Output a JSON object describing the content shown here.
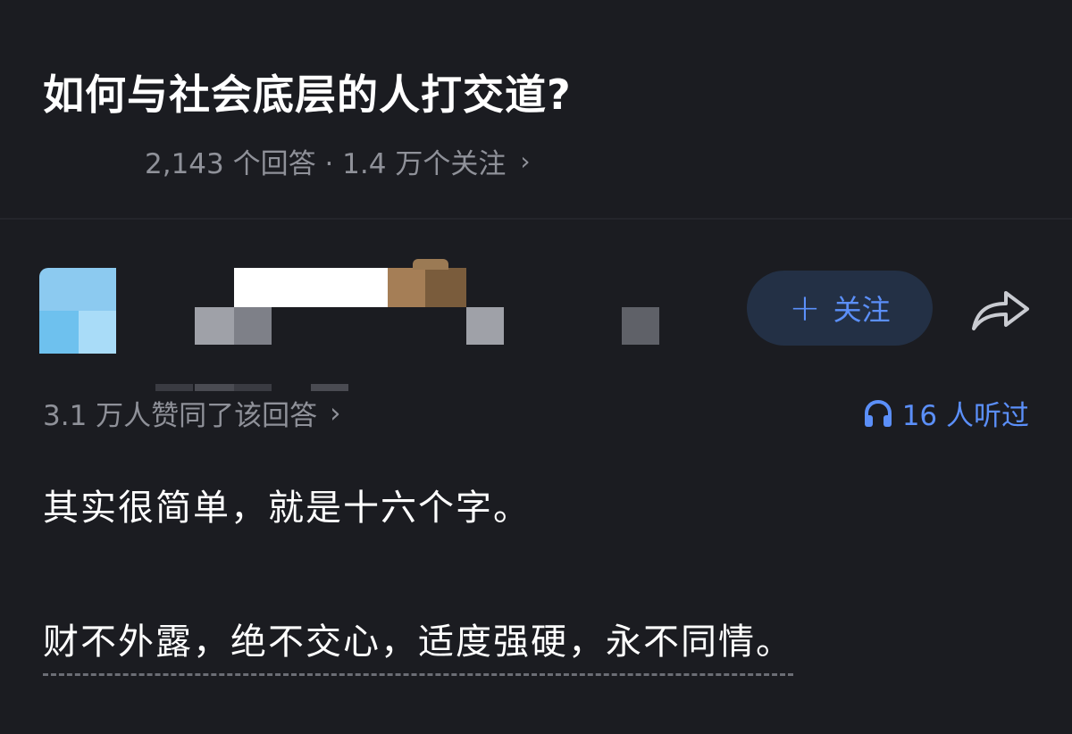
{
  "question": {
    "title": "如何与社会底层的人打交道?",
    "meta": "2,143 个回答 · 1.4 万个关注",
    "chevron": "›"
  },
  "author": {
    "follow_label": "关注",
    "follow_plus": "+",
    "share_icon": "share-arrow-icon"
  },
  "stats": {
    "votes": "3.1 万人赞同了该回答",
    "chevron": "›",
    "listen_icon": "headphones-icon",
    "listened": "16 人听过"
  },
  "answer": {
    "paragraph1": "其实很简单，就是十六个字。",
    "paragraph2": "财不外露，绝不交心，适度强硬，永不同情。"
  },
  "colors": {
    "background": "#1b1c21",
    "accent": "#5b8ff9",
    "muted": "#8f9199",
    "follow_bg": "#233045"
  }
}
